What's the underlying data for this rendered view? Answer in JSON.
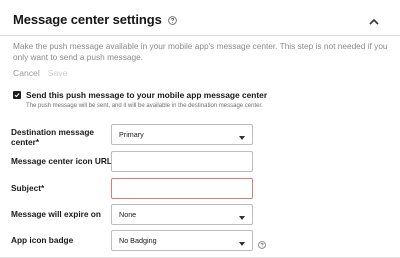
{
  "header": {
    "title": "Message center settings"
  },
  "description": "Make the push message available in your mobile app's message center. This step is not needed if you only want to send a push message.",
  "actions": {
    "cancel_label": "Cancel",
    "save_label": "Save"
  },
  "send_to_message_center": {
    "checked": true,
    "label": "Send this push message to your mobile app message center",
    "sub_label": "The push message will be sent, and it will be available in the destination message center."
  },
  "fields": {
    "destination": {
      "label_line1": "Destination message",
      "label_line2": "center*",
      "value": "Primary"
    },
    "icon_url": {
      "label": "Message center icon URL",
      "value": ""
    },
    "subject": {
      "label": "Subject*",
      "value": ""
    },
    "expire": {
      "label": "Message will expire on",
      "value": "None"
    },
    "app_icon_badge": {
      "label": "App icon badge",
      "value": "No Badging"
    }
  },
  "colors": {
    "error_border": "#e07b70",
    "muted_text": "#8a8a8a",
    "checkbox_fill": "#1f1f1f"
  },
  "icons": {
    "title_help": "help-circle-icon",
    "collapse": "chevron-up-icon",
    "select_caret": "caret-down-icon",
    "badge_help": "help-circle-icon"
  }
}
